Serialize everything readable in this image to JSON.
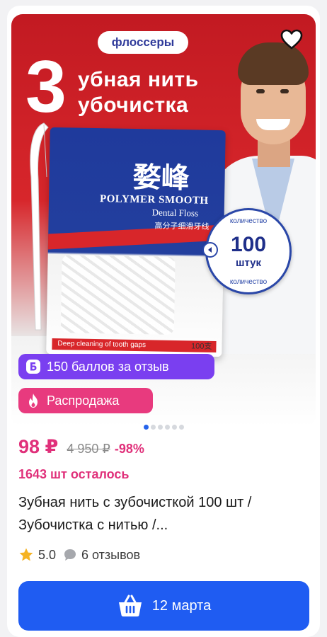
{
  "image": {
    "category_pill": "флоссеры",
    "headline_digit": "3",
    "headline_line1": "убная нить",
    "headline_line2": "убочистка",
    "package": {
      "brand_cn": "婺峰",
      "brand_en": "POLYMER SMOOTH",
      "brand_sub": "Dental Floss",
      "brand_cn2": "高分子细滑牙线",
      "bottom_text": "Deep cleaning of tooth gaps",
      "count": "100支"
    },
    "count_badge": {
      "ring_text": "количество",
      "number": "100",
      "unit": "штук"
    },
    "favorite_icon": "heart-outline-icon"
  },
  "chips": {
    "review_icon": "bonus-b-icon",
    "review_label": "150 баллов за отзыв",
    "review_color": "#7a3ff0",
    "sale_icon": "fire-icon",
    "sale_label": "Распродажа",
    "sale_color": "#e83a7e"
  },
  "pager": {
    "total": 6,
    "active": 1
  },
  "price": {
    "current": "98 ₽",
    "old": "4 950 ₽",
    "discount": "-98%",
    "accent_color": "#e0307a"
  },
  "stock": "1643 шт осталось",
  "title": "Зубная нить с зубочисткой 100 шт / Зубочистка с нитью /...",
  "rating": {
    "score": "5.0",
    "reviews": "6 отзывов"
  },
  "cart_button": {
    "label": "12 марта",
    "icon": "basket-icon",
    "color": "#1f5cf2"
  }
}
